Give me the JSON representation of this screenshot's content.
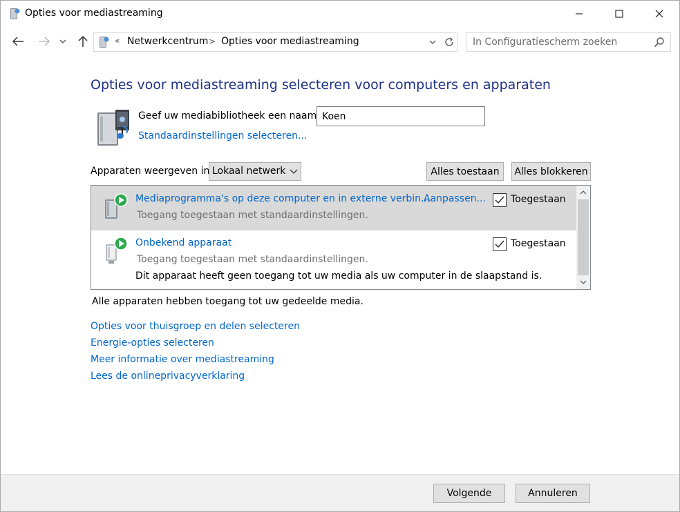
{
  "window": {
    "title": "Opties voor mediastreaming"
  },
  "address": {
    "overflow": "«",
    "segments": [
      "Netwerkcentrum",
      "Opties voor mediastreaming"
    ],
    "separator": ">"
  },
  "search": {
    "placeholder": "In Configuratiescherm zoeken"
  },
  "main": {
    "heading": "Opties voor mediastreaming selecteren voor computers en apparaten",
    "library_name_label": "Geef uw mediabibliotheek een naam:",
    "library_name_value": "Koen",
    "default_settings_link": "Standaardinstellingen selecteren...",
    "show_devices_label": "Apparaten weergeven in:",
    "show_devices_selected": "Lokaal netwerk",
    "allow_all_label": "Alles toestaan",
    "block_all_label": "Alles blokkeren"
  },
  "devices": [
    {
      "name": "Mediaprogramma's op deze computer en in externe verbin...",
      "subtitle": "Toegang toegestaan met standaardinstellingen.",
      "customize": "Aanpassen...",
      "checked": true,
      "check_label": "Toegestaan",
      "selected": true
    },
    {
      "name": "Onbekend apparaat",
      "subtitle": "Toegang toegestaan met standaardinstellingen.",
      "note": "Dit apparaat heeft geen toegang tot uw media als uw computer in de slaapstand is.",
      "checked": true,
      "check_label": "Toegestaan",
      "selected": false
    }
  ],
  "status_text": "Alle apparaten hebben toegang tot uw gedeelde media.",
  "links": [
    "Opties voor thuisgroep en delen selecteren",
    "Energie-opties selecteren",
    "Meer informatie over mediastreaming",
    "Lees de onlineprivacyverklaring"
  ],
  "footer": {
    "next_label": "Volgende",
    "cancel_label": "Annuleren"
  },
  "colors": {
    "heading": "#1e3287",
    "link": "#0066cc",
    "selected_row": "#d9d9d9",
    "footer_bg": "#f0f0f0",
    "play_green": "#2fa84f"
  }
}
